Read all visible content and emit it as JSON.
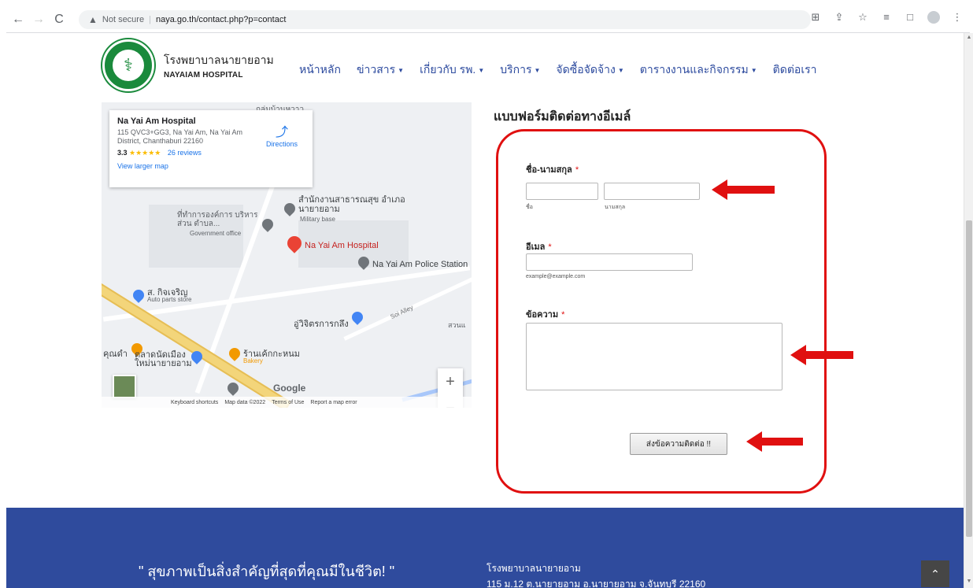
{
  "browser": {
    "security_label": "Not secure",
    "url": "naya.go.th/contact.php?p=contact"
  },
  "header": {
    "brand_th": "โรงพยาบาลนายายอาม",
    "brand_en": "NAYAIAM HOSPITAL",
    "menu": [
      {
        "label": "หน้าหลัก",
        "has_dropdown": false
      },
      {
        "label": "ข่าวสาร",
        "has_dropdown": true
      },
      {
        "label": "เกี่ยวกับ รพ.",
        "has_dropdown": true
      },
      {
        "label": "บริการ",
        "has_dropdown": true
      },
      {
        "label": "จัดซื้อจัดจ้าง",
        "has_dropdown": true
      },
      {
        "label": "ตารางงานและกิจกรรม",
        "has_dropdown": true
      },
      {
        "label": "ติดต่อเรา",
        "has_dropdown": false
      }
    ]
  },
  "map": {
    "place_name": "Na Yai Am Hospital",
    "address": "115 QVC3+GG3, Na Yai Am, Na Yai Am District, Chanthaburi 22160",
    "rating": "3.3",
    "stars": "★★★★★",
    "reviews": "26 reviews",
    "larger_map": "View larger map",
    "directions": "Directions",
    "labels": {
      "health_office": "สำนักงานสาธารณสุข อำเภอนายายอาม",
      "military_base": "Military base",
      "gov_office_th": "ที่ทำการองค์การ บริหารส่วน ตำบล...",
      "gov_office": "Government office",
      "hospital": "Na Yai Am Hospital",
      "police": "Na Yai Am Police Station",
      "parts_th": "ส. กิจเจริญ",
      "parts_en": "Auto parts store",
      "garage": "อู่วิจิตรการกลึง",
      "alley": "Soi Alley",
      "market": "ตลาดนัดเมือง ใหม่นายายอาม",
      "bakery_th": "ร้านเค้กกะหนม",
      "bakery_en": "Bakery",
      "kunda": "คุณดำ",
      "suan": "สวนแ",
      "top_label": "กลุ่มบ้านหวาว"
    },
    "google": "Google",
    "footer": {
      "keyboard": "Keyboard shortcuts",
      "mapdata": "Map data ©2022",
      "terms": "Terms of Use",
      "report": "Report a map error"
    },
    "zoom_in": "+",
    "zoom_out": "−"
  },
  "form": {
    "title": "แบบฟอร์มติดต่อทางอีเมล์",
    "name_label": "ชื่อ-นามสกุล",
    "first_sub": "ชื่อ",
    "last_sub": "นามสกุล",
    "email_label": "อีเมล",
    "email_sub": "example@example.com",
    "message_label": "ข้อความ",
    "required_mark": "*",
    "submit": "ส่งข้อความติดต่อ !!",
    "first_value": "",
    "last_value": "",
    "email_value": "",
    "message_value": ""
  },
  "footer": {
    "quote": "\" สุขภาพเป็นสิ่งสำคัญที่สุดที่คุณมีในชีวิต! \"",
    "addr_line1": "โรงพยาบาลนายายอาม",
    "addr_line2": "115 ม.12 ต.นายายอาม อ.นายายอาม จ.จันทบุรี 22160",
    "top_icon": "chevron-up"
  },
  "colors": {
    "nav_text": "#2c4a9e",
    "footer_bg": "#2f4b9d",
    "annotation_red": "#e01010",
    "logo_green": "#1a8a3c"
  }
}
